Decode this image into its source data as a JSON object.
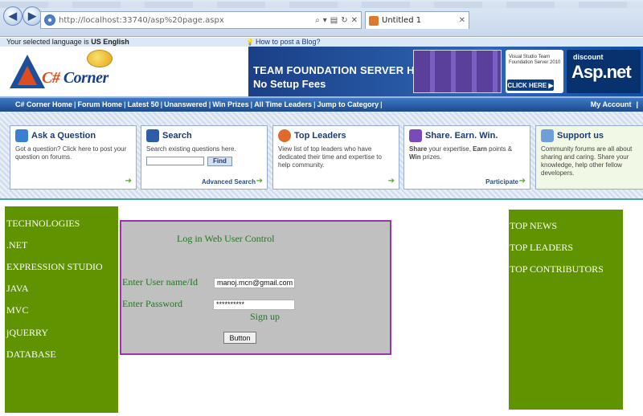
{
  "browser": {
    "url": "http://localhost:33740/asp%20page.aspx",
    "tab_title": "Untitled 1"
  },
  "infobar": {
    "language_prefix": "Your selected language is ",
    "language": "US English",
    "howto_link": "How to post a Blog?"
  },
  "header": {
    "logo_text_prefix": "C#",
    "logo_text_suffix": " Corner",
    "banner": {
      "line1": "TEAM FOUNDATION SERVER HOSTING",
      "line2": "No Setup Fees",
      "product": "Visual Studio Team Foundation Server 2010",
      "cta": "CLICK HERE ▶",
      "brand_small": "discount",
      "brand_big": "Asp.net"
    }
  },
  "nav": {
    "links": [
      "C# Corner Home",
      "Forum Home",
      "Latest 50",
      "Unanswered",
      "Win Prizes",
      "All Time Leaders",
      "Jump to Category"
    ],
    "account": "My Account",
    "account_sep": "|"
  },
  "panels": {
    "ask": {
      "title": "Ask a Question",
      "text": "Got a question? Click here to post your question on forums."
    },
    "search": {
      "title": "Search",
      "text": "Search existing questions here.",
      "button": "Find",
      "more": "Advanced Search"
    },
    "leaders": {
      "title": "Top Leaders",
      "text": "View list of top leaders who have dedicated their time and expertise to help community."
    },
    "share": {
      "title": "Share. Earn. Win.",
      "text_b1": "Share",
      "text_1": " your expertise, ",
      "text_b2": "Earn",
      "text_2": " points & ",
      "text_b3": "Win",
      "text_3": " prizes.",
      "more": "Participate"
    },
    "support": {
      "title": "Support us",
      "text": "Community forums are all about sharing and caring. Share your knowledge, help other fellow developers."
    }
  },
  "left_nav": [
    "TECHNOLOGIES",
    ".NET",
    "EXPRESSION STUDIO",
    "JAVA",
    "MVC",
    "jQUERRY",
    "DATABASE"
  ],
  "right_nav": [
    "TOP NEWS",
    "TOP LEADERS",
    "TOP CONTRIBUTORS"
  ],
  "login": {
    "title": "Log in Web User Control",
    "username_label": "Enter User name/Id",
    "username_value": "manoj.mcn@gmail.com",
    "password_label": "Enter Password",
    "password_value": "**********",
    "signup": "Sign up",
    "button": "Button"
  },
  "colors": {
    "nav_green": "#5f9300",
    "login_border": "#9c33b3",
    "login_text": "#1f7a1f",
    "navbar_blue": "#1c4b8f"
  }
}
